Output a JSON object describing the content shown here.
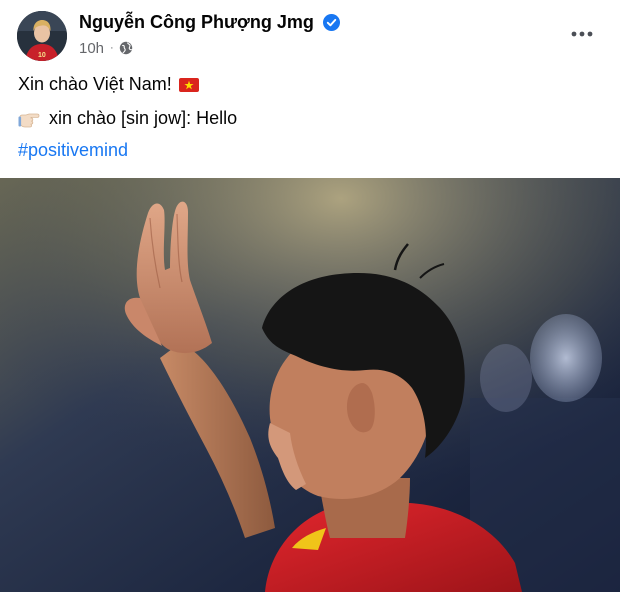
{
  "post": {
    "author_name": "Nguyễn Công Phượng Jmg",
    "time": "10h",
    "privacy_icon": "globe-icon",
    "verified_icon": "verified-badge-icon",
    "more_icon": "more-options-icon",
    "jersey_number": "10",
    "lines": {
      "greeting": "Xin chào Việt Nam!",
      "pronunciation": "xin chào [sin jow]: Hello",
      "hashtag": "#positivemind"
    },
    "emojis": {
      "flag": "vietnam-flag-icon",
      "pointing": "pointing-right-hand-icon"
    },
    "photo": "footballer-waving-photo"
  },
  "colors": {
    "link": "#1877f2",
    "secondary_text": "#65676b",
    "verified": "#1877f2",
    "jersey_red": "#d8212a"
  }
}
